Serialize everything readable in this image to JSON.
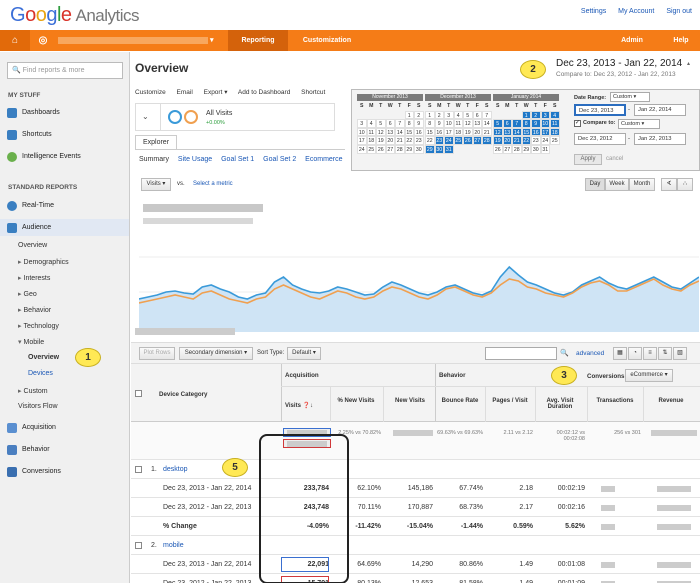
{
  "header": {
    "logo_google": "Google",
    "logo_analytics": "Analytics",
    "links": [
      "Settings",
      "My Account",
      "Sign out"
    ]
  },
  "nav": {
    "reporting": "Reporting",
    "customization": "Customization",
    "admin": "Admin",
    "help": "Help"
  },
  "sidebar": {
    "search_placeholder": "Find reports & more",
    "my_stuff": "MY STUFF",
    "dashboards": "Dashboards",
    "shortcuts": "Shortcuts",
    "intelligence": "Intelligence Events",
    "standard_reports": "STANDARD REPORTS",
    "realtime": "Real-Time",
    "audience": "Audience",
    "overview": "Overview",
    "demographics": "Demographics",
    "interests": "Interests",
    "geo": "Geo",
    "behavior_sub": "Behavior",
    "technology": "Technology",
    "mobile": "Mobile",
    "mobile_overview": "Overview",
    "devices": "Devices",
    "custom": "Custom",
    "visitors_flow": "Visitors Flow",
    "acquisition": "Acquisition",
    "behavior": "Behavior",
    "conversions": "Conversions"
  },
  "callouts": [
    "1",
    "2",
    "3",
    "5"
  ],
  "main": {
    "title": "Overview",
    "toolbar": [
      "Customize",
      "Email",
      "Export ▾",
      "Add to Dashboard",
      "Shortcut"
    ],
    "date_range": "Dec 23, 2013 - Jan 22, 2014",
    "compare_to": "Compare to: Dec 23, 2012 - Jan 22, 2013",
    "segment": "All Visits",
    "segment_pct": "+0.00%",
    "explorer_tab": "Explorer",
    "subtabs": [
      "Summary",
      "Site Usage",
      "Goal Set 1",
      "Goal Set 2",
      "Ecommerce"
    ]
  },
  "calendar": {
    "months": [
      "November 2013",
      "December 2013",
      "January 2014"
    ],
    "weekdays": [
      "S",
      "M",
      "T",
      "W",
      "T",
      "F",
      "S"
    ],
    "date_range_label": "Date Range:",
    "date_range_option": "Custom",
    "start": "Dec 23, 2013",
    "end": "Jan 22, 2014",
    "compare_label": "Compare to:",
    "compare_option": "Custom",
    "compare_start": "Dec 23, 2012",
    "compare_end": "Jan 22, 2013",
    "apply": "Apply",
    "cancel": "cancel"
  },
  "chart_controls": {
    "metric": "Visits",
    "vs": "vs.",
    "select_metric": "Select a metric",
    "periods": [
      "Day",
      "Week",
      "Month"
    ]
  },
  "table_bar": {
    "plot_rows": "Plot Rows",
    "secondary": "Secondary dimension ▾",
    "sort_type": "Sort Type:",
    "sort_value": "Default ▾",
    "advanced": "advanced"
  },
  "table": {
    "dim_header": "Device Category",
    "group_acq": "Acquisition",
    "group_beh": "Behavior",
    "conversions_label": "Conversions",
    "conversions_value": "eCommerce ▾",
    "columns": [
      "Visits",
      "% New Visits",
      "New Visits",
      "Bounce Rate",
      "Pages / Visit",
      "Avg. Visit Duration",
      "Transactions",
      "Revenue"
    ],
    "summary": {
      "pct_new": "2.25% vs 70.82%",
      "bounce": "69.63% vs 69.63%",
      "pages": "2.11 vs 2.12",
      "duration": "00:02:12 vs 00:02:08",
      "transactions": "256 vs 301"
    },
    "groups": [
      {
        "index": "1.",
        "name": "desktop",
        "rows": [
          {
            "label": "Dec 23, 2013 - Jan 22, 2014",
            "visits": "233,784",
            "pct_new": "62.10%",
            "new_visits": "145,186",
            "bounce": "67.74%",
            "pages": "2.18",
            "duration": "00:02:19"
          },
          {
            "label": "Dec 23, 2012 - Jan 22, 2013",
            "visits": "243,748",
            "pct_new": "70.11%",
            "new_visits": "170,887",
            "bounce": "68.73%",
            "pages": "2.17",
            "duration": "00:02:16"
          },
          {
            "label": "% Change",
            "visits": "-4.09%",
            "pct_new": "-11.42%",
            "new_visits": "-15.04%",
            "bounce": "-1.44%",
            "pages": "0.59%",
            "duration": "5.62%"
          }
        ]
      },
      {
        "index": "2.",
        "name": "mobile",
        "rows": [
          {
            "label": "Dec 23, 2013 - Jan 22, 2014",
            "visits": "22,091",
            "pct_new": "64.69%",
            "new_visits": "14,290",
            "bounce": "80.86%",
            "pages": "1.49",
            "duration": "00:01:08"
          },
          {
            "label": "Dec 23, 2012 - Jan 22, 2013",
            "visits": "15,791",
            "pct_new": "80.13%",
            "new_visits": "12,653",
            "bounce": "81.58%",
            "pages": "1.49",
            "duration": "00:01:09"
          }
        ]
      }
    ]
  },
  "colors": {
    "nav": "#f57c17",
    "selected": "#1f78c8",
    "series_current": "#3a9ad9",
    "series_previous": "#f0a050"
  }
}
